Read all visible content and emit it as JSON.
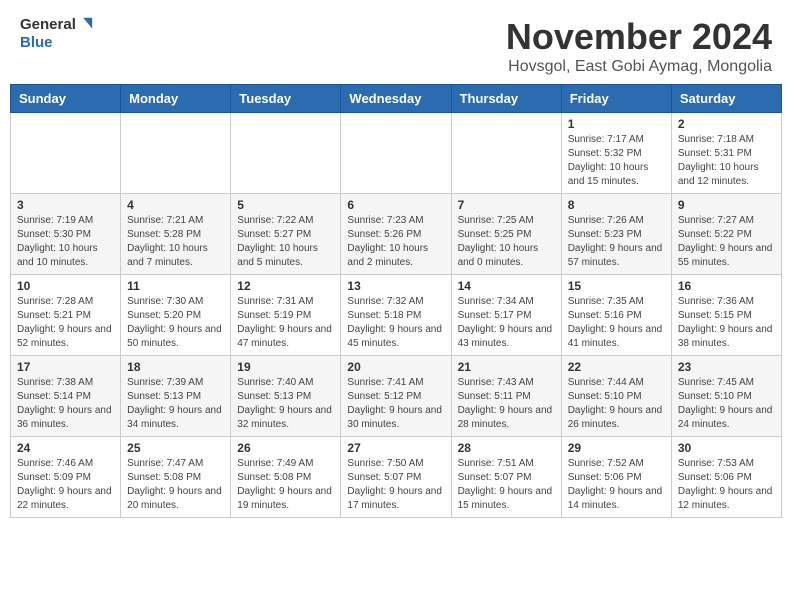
{
  "header": {
    "logo_line1": "General",
    "logo_line2": "Blue",
    "month_title": "November 2024",
    "subtitle": "Hovsgol, East Gobi Aymag, Mongolia"
  },
  "days_of_week": [
    "Sunday",
    "Monday",
    "Tuesday",
    "Wednesday",
    "Thursday",
    "Friday",
    "Saturday"
  ],
  "weeks": [
    {
      "days": [
        {
          "date": "",
          "info": ""
        },
        {
          "date": "",
          "info": ""
        },
        {
          "date": "",
          "info": ""
        },
        {
          "date": "",
          "info": ""
        },
        {
          "date": "",
          "info": ""
        },
        {
          "date": "1",
          "info": "Sunrise: 7:17 AM\nSunset: 5:32 PM\nDaylight: 10 hours and 15 minutes."
        },
        {
          "date": "2",
          "info": "Sunrise: 7:18 AM\nSunset: 5:31 PM\nDaylight: 10 hours and 12 minutes."
        }
      ]
    },
    {
      "days": [
        {
          "date": "3",
          "info": "Sunrise: 7:19 AM\nSunset: 5:30 PM\nDaylight: 10 hours and 10 minutes."
        },
        {
          "date": "4",
          "info": "Sunrise: 7:21 AM\nSunset: 5:28 PM\nDaylight: 10 hours and 7 minutes."
        },
        {
          "date": "5",
          "info": "Sunrise: 7:22 AM\nSunset: 5:27 PM\nDaylight: 10 hours and 5 minutes."
        },
        {
          "date": "6",
          "info": "Sunrise: 7:23 AM\nSunset: 5:26 PM\nDaylight: 10 hours and 2 minutes."
        },
        {
          "date": "7",
          "info": "Sunrise: 7:25 AM\nSunset: 5:25 PM\nDaylight: 10 hours and 0 minutes."
        },
        {
          "date": "8",
          "info": "Sunrise: 7:26 AM\nSunset: 5:23 PM\nDaylight: 9 hours and 57 minutes."
        },
        {
          "date": "9",
          "info": "Sunrise: 7:27 AM\nSunset: 5:22 PM\nDaylight: 9 hours and 55 minutes."
        }
      ]
    },
    {
      "days": [
        {
          "date": "10",
          "info": "Sunrise: 7:28 AM\nSunset: 5:21 PM\nDaylight: 9 hours and 52 minutes."
        },
        {
          "date": "11",
          "info": "Sunrise: 7:30 AM\nSunset: 5:20 PM\nDaylight: 9 hours and 50 minutes."
        },
        {
          "date": "12",
          "info": "Sunrise: 7:31 AM\nSunset: 5:19 PM\nDaylight: 9 hours and 47 minutes."
        },
        {
          "date": "13",
          "info": "Sunrise: 7:32 AM\nSunset: 5:18 PM\nDaylight: 9 hours and 45 minutes."
        },
        {
          "date": "14",
          "info": "Sunrise: 7:34 AM\nSunset: 5:17 PM\nDaylight: 9 hours and 43 minutes."
        },
        {
          "date": "15",
          "info": "Sunrise: 7:35 AM\nSunset: 5:16 PM\nDaylight: 9 hours and 41 minutes."
        },
        {
          "date": "16",
          "info": "Sunrise: 7:36 AM\nSunset: 5:15 PM\nDaylight: 9 hours and 38 minutes."
        }
      ]
    },
    {
      "days": [
        {
          "date": "17",
          "info": "Sunrise: 7:38 AM\nSunset: 5:14 PM\nDaylight: 9 hours and 36 minutes."
        },
        {
          "date": "18",
          "info": "Sunrise: 7:39 AM\nSunset: 5:13 PM\nDaylight: 9 hours and 34 minutes."
        },
        {
          "date": "19",
          "info": "Sunrise: 7:40 AM\nSunset: 5:13 PM\nDaylight: 9 hours and 32 minutes."
        },
        {
          "date": "20",
          "info": "Sunrise: 7:41 AM\nSunset: 5:12 PM\nDaylight: 9 hours and 30 minutes."
        },
        {
          "date": "21",
          "info": "Sunrise: 7:43 AM\nSunset: 5:11 PM\nDaylight: 9 hours and 28 minutes."
        },
        {
          "date": "22",
          "info": "Sunrise: 7:44 AM\nSunset: 5:10 PM\nDaylight: 9 hours and 26 minutes."
        },
        {
          "date": "23",
          "info": "Sunrise: 7:45 AM\nSunset: 5:10 PM\nDaylight: 9 hours and 24 minutes."
        }
      ]
    },
    {
      "days": [
        {
          "date": "24",
          "info": "Sunrise: 7:46 AM\nSunset: 5:09 PM\nDaylight: 9 hours and 22 minutes."
        },
        {
          "date": "25",
          "info": "Sunrise: 7:47 AM\nSunset: 5:08 PM\nDaylight: 9 hours and 20 minutes."
        },
        {
          "date": "26",
          "info": "Sunrise: 7:49 AM\nSunset: 5:08 PM\nDaylight: 9 hours and 19 minutes."
        },
        {
          "date": "27",
          "info": "Sunrise: 7:50 AM\nSunset: 5:07 PM\nDaylight: 9 hours and 17 minutes."
        },
        {
          "date": "28",
          "info": "Sunrise: 7:51 AM\nSunset: 5:07 PM\nDaylight: 9 hours and 15 minutes."
        },
        {
          "date": "29",
          "info": "Sunrise: 7:52 AM\nSunset: 5:06 PM\nDaylight: 9 hours and 14 minutes."
        },
        {
          "date": "30",
          "info": "Sunrise: 7:53 AM\nSunset: 5:06 PM\nDaylight: 9 hours and 12 minutes."
        }
      ]
    }
  ]
}
